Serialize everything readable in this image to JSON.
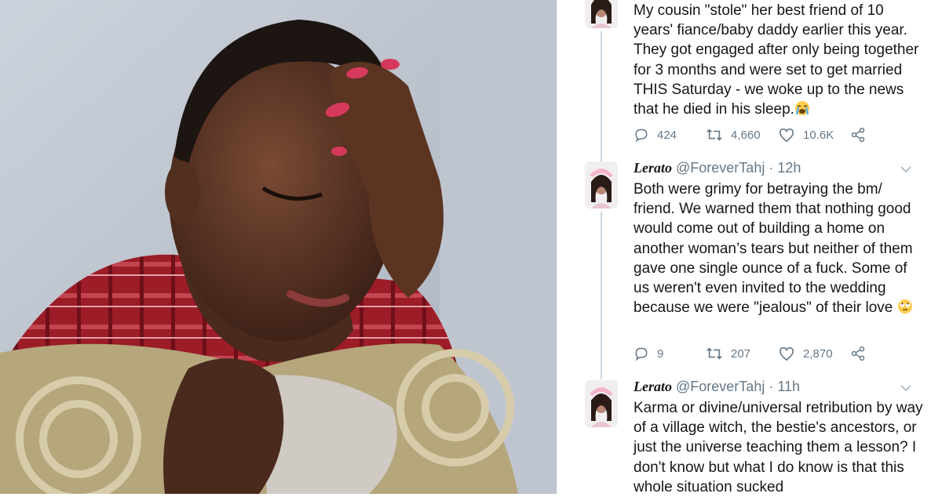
{
  "tweets": [
    {
      "name": "",
      "handle": "",
      "time": "",
      "text": "My cousin \"stole\" her best friend of 10 years' fiance/baby daddy earlier this year. They got engaged after only being together for 3 months and were set to get married THIS Saturday - we woke up to the news that he died in his sleep.",
      "emoji": "loudly-crying-face",
      "replies": "424",
      "retweets": "4,660",
      "likes": "10.6K"
    },
    {
      "name": "Lerato",
      "handle": "@ForeverTahj · 12h",
      "text": "Both were grimy for betraying the bm/ friend. We warned them that nothing good would come out of building a home on another woman’s tears but neither of them gave one single ounce of a fuck. Some of us weren't even invited to the wedding because we were \"jealous\" of their love",
      "emoji": "face-with-rolling-eyes",
      "replies": "9",
      "retweets": "207",
      "likes": "2,870"
    },
    {
      "name": "Lerato",
      "handle": "@ForeverTahj · 11h",
      "text": "Karma or divine/universal retribution by way of a village witch, the bestie's ancestors, or just the universe teaching them a lesson? I don't know but what I do know is that this whole situation sucked"
    }
  ],
  "colors": {
    "text": "#14171a",
    "muted": "#657786",
    "line": "#cdd6dd"
  },
  "icons": [
    "reply-icon",
    "retweet-icon",
    "like-icon",
    "share-icon",
    "chevron-down-icon"
  ]
}
